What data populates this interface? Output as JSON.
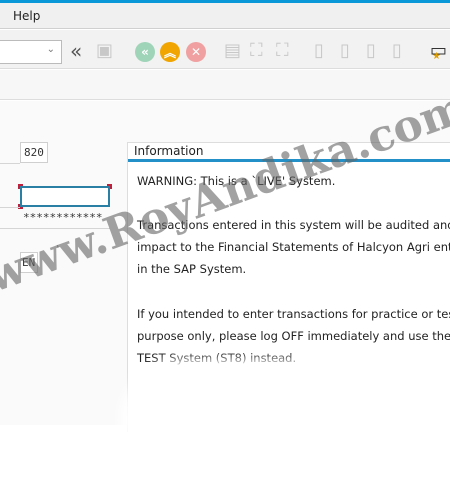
{
  "menu": {
    "help": "Help"
  },
  "toolbar": {
    "command_field": "",
    "chevron": "⌄"
  },
  "form": {
    "client": "820",
    "user": "",
    "password": "************",
    "language": "EN"
  },
  "info": {
    "title": "Information",
    "lines": [
      "WARNING:  This is a `LIVE' System.",
      "Transactions entered in this system will be audited and m",
      "impact to the Financial Statements of Halcyon Agri entitie",
      "in the SAP System.",
      "If you intended to enter transactions for practice or test",
      "purpose only, please log OFF immediately and use the",
      "TEST System (ST8) instead."
    ]
  },
  "watermark": "www.RoyAndika.com"
}
